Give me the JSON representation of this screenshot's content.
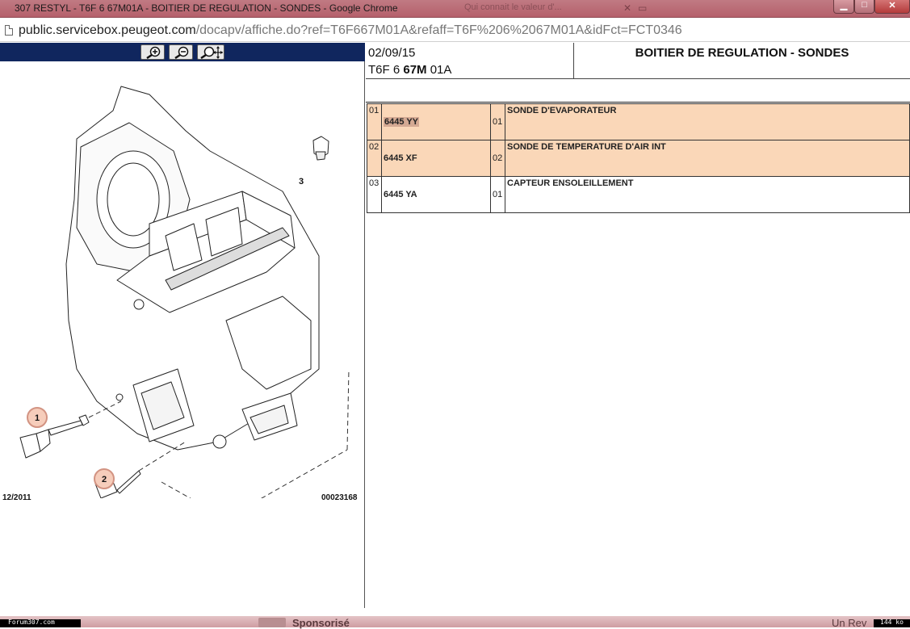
{
  "window": {
    "title": "307 RESTYL - T6F 6 67M01A - BOITIER DE REGULATION - SONDES - Google Chrome",
    "ghost_tab": "Qui connait le valeur d'..."
  },
  "address_bar": {
    "host": "public.servicebox.peugeot.com",
    "path": "/docapv/affiche.do?ref=T6F667M01A&refaff=T6F%206%2067M01A&idFct=FCT0346"
  },
  "diagram": {
    "date": "12/2011",
    "reference": "00023168",
    "callouts": [
      "1",
      "2",
      "3"
    ]
  },
  "header": {
    "date": "02/09/15",
    "ref_prefix": "T6F 6 ",
    "ref_bold": "67M",
    "ref_suffix": " 01A",
    "title": "BOITIER DE REGULATION - SONDES"
  },
  "parts": [
    {
      "index": "01",
      "ref": "6445 YY",
      "qty": "01",
      "description": "SONDE D'EVAPORATEUR",
      "highlight": true
    },
    {
      "index": "02",
      "ref": "6445 XF",
      "qty": "02",
      "description": "SONDE DE TEMPERATURE D'AIR INT",
      "highlight": true
    },
    {
      "index": "03",
      "ref": "6445 YA",
      "qty": "01",
      "description": "CAPTEUR ENSOLEILLEMENT",
      "highlight": false
    }
  ],
  "bottom_strip": {
    "left_label": "Forum307.com",
    "sponsor": "Sponsorisé",
    "right_text": "Un Rev",
    "size": "144 ko"
  },
  "icons": {
    "zoom_in": "zoom-in-icon",
    "zoom_out": "zoom-out-icon",
    "pan": "zoom-pan-icon",
    "document": "page-icon"
  }
}
